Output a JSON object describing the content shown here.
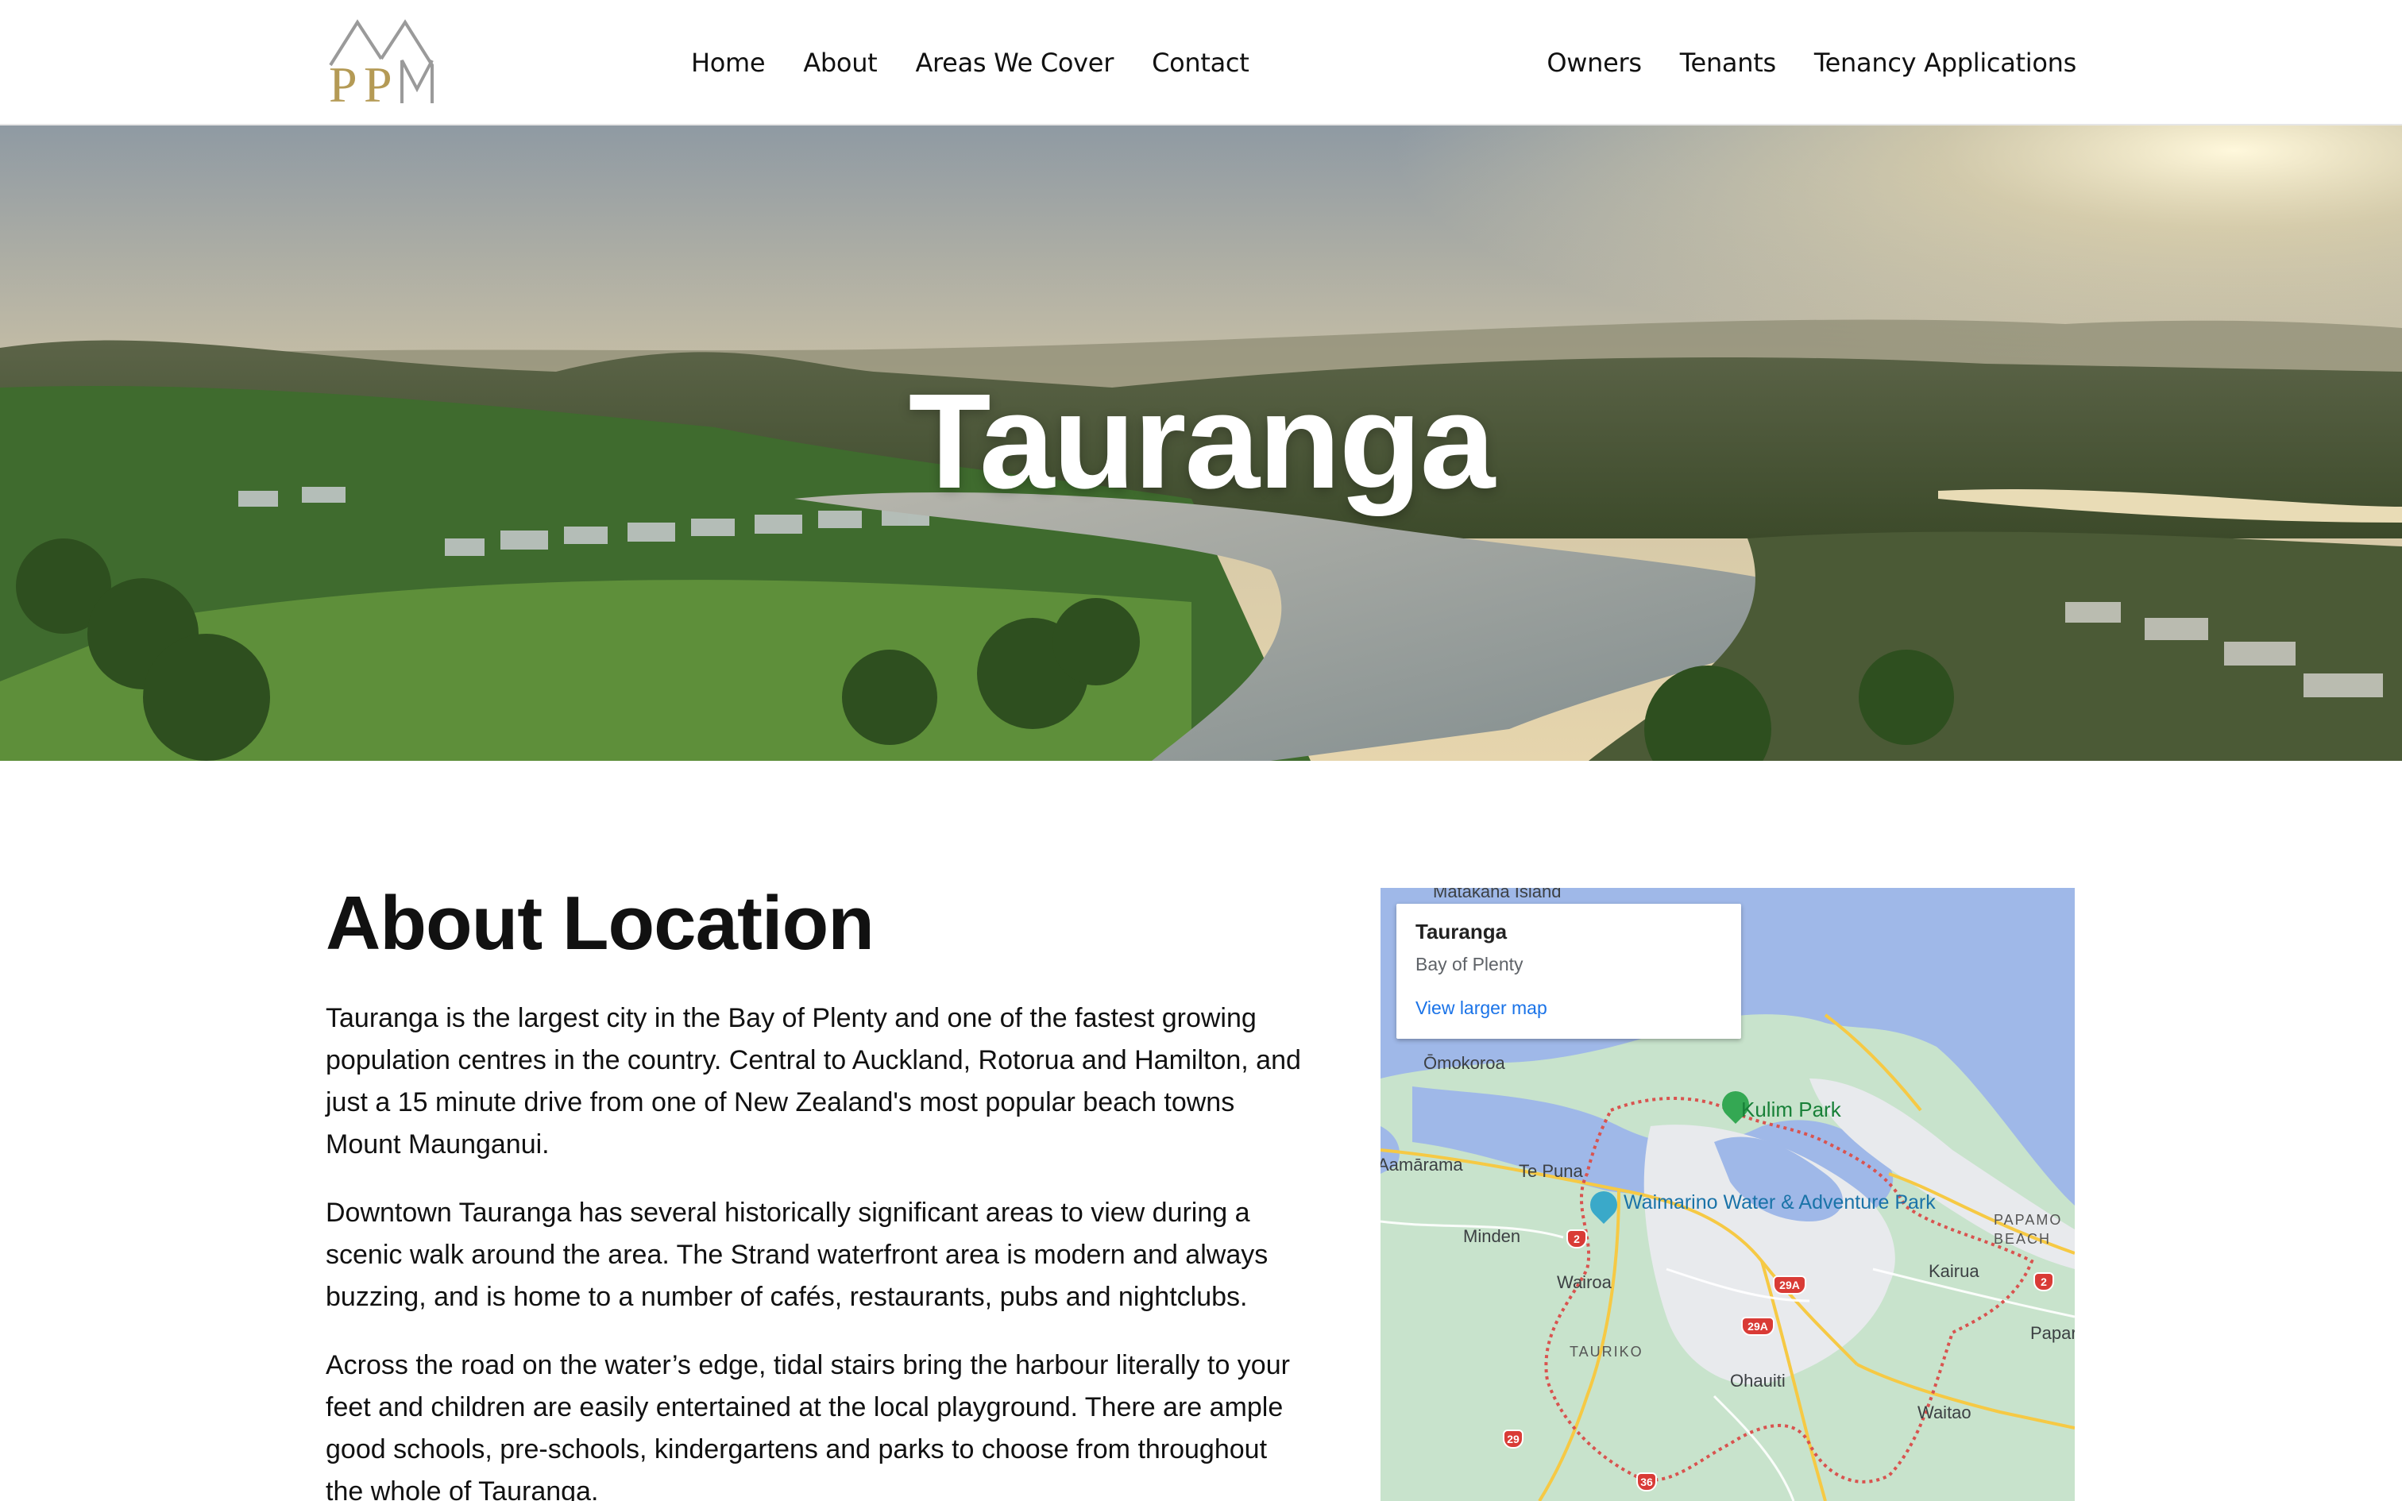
{
  "header": {
    "logo_text": "PPM",
    "nav_left": [
      {
        "label": "Home"
      },
      {
        "label": "About"
      },
      {
        "label": "Areas We Cover"
      },
      {
        "label": "Contact"
      }
    ],
    "nav_right": [
      {
        "label": "Owners"
      },
      {
        "label": "Tenants"
      },
      {
        "label": "Tenancy Applications"
      }
    ]
  },
  "hero": {
    "title": "Tauranga"
  },
  "about": {
    "heading": "About Location",
    "paragraphs": [
      "Tauranga is the largest city in the Bay of Plenty and one of the fastest growing population centres in the country. Central to Auckland, Rotorua and Hamilton, and just a 15 minute drive from one of New Zealand's most popular beach towns Mount Maunganui.",
      "Downtown Tauranga has several historically significant areas to view during a scenic walk around the area. The Strand waterfront area is modern and always buzzing, and is home to a number of cafés, restaurants, pubs and nightclubs.",
      "Across the road on the water’s edge, tidal stairs bring the harbour literally to your feet and children are easily entertained at the local playground. There are ample good schools, pre-schools, kindergartens and parks to choose from throughout the whole of Tauranga."
    ]
  },
  "map": {
    "card_title": "Tauranga",
    "card_subtitle": "Bay of Plenty",
    "card_link": "View larger map",
    "labels": {
      "matakana": "Matakana Island",
      "omokoroa": "Ōmokoroa",
      "kulim": "Kulim Park",
      "tamarama": "Aamārama",
      "tepuna": "Te Puna",
      "waimarino": "Waimarino Water & Adventure Park",
      "minden": "Minden",
      "papamoa": "PAPAMO BEACH",
      "wairoa": "Wairoa",
      "kairua": "Kairua",
      "papar": "Papar",
      "tauriko": "TAURIKO",
      "ohauiti": "Ohauiti",
      "waitao": "Waitao"
    },
    "route_shields": [
      "2",
      "2",
      "29A",
      "29A",
      "29",
      "36"
    ]
  },
  "colors": {
    "map_water": "#9fb8e8",
    "map_land": "#c8e3cc",
    "boundary": "#d9534f",
    "link": "#1a73e8"
  }
}
